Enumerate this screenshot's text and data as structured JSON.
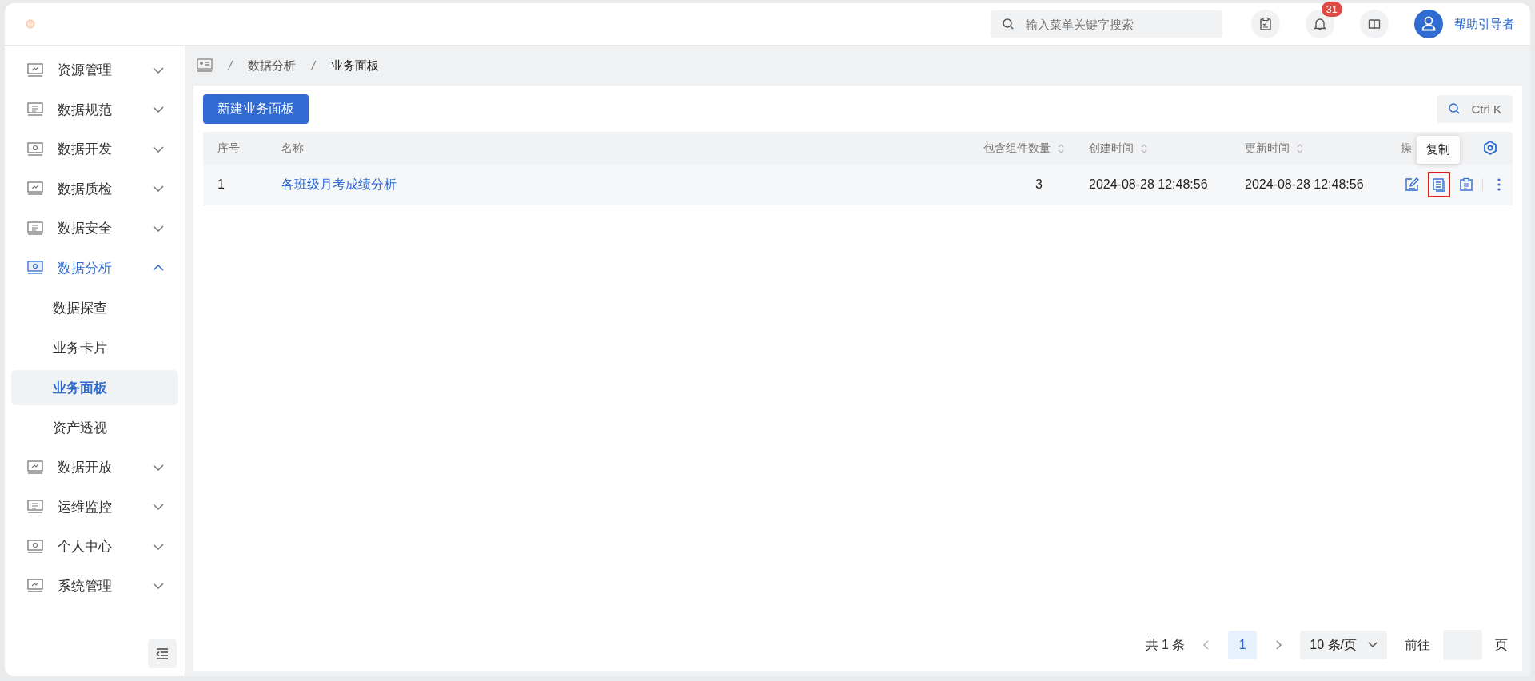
{
  "header": {
    "search": {
      "placeholder": "输入菜单关键字搜索"
    },
    "notifications": {
      "count": "31"
    },
    "user": {
      "name": "帮助引导者"
    }
  },
  "sidebar": {
    "items": [
      {
        "label": "资源管理",
        "expanded": false,
        "selected": false
      },
      {
        "label": "数据规范",
        "expanded": false,
        "selected": false
      },
      {
        "label": "数据开发",
        "expanded": false,
        "selected": false
      },
      {
        "label": "数据质检",
        "expanded": false,
        "selected": false
      },
      {
        "label": "数据安全",
        "expanded": false,
        "selected": false
      },
      {
        "label": "数据分析",
        "expanded": true,
        "selected": true,
        "children": [
          {
            "label": "数据探查",
            "selected": false
          },
          {
            "label": "业务卡片",
            "selected": false
          },
          {
            "label": "业务面板",
            "selected": true
          },
          {
            "label": "资产透视",
            "selected": false
          }
        ]
      },
      {
        "label": "数据开放",
        "expanded": false,
        "selected": false
      },
      {
        "label": "运维监控",
        "expanded": false,
        "selected": false
      },
      {
        "label": "个人中心",
        "expanded": false,
        "selected": false
      },
      {
        "label": "系统管理",
        "expanded": false,
        "selected": false
      }
    ]
  },
  "breadcrumb": [
    "数据分析",
    "业务面板"
  ],
  "toolbar": {
    "new_button": "新建业务面板",
    "search_shortcut": "Ctrl K"
  },
  "table": {
    "columns": [
      {
        "label": "序号",
        "sortable": false
      },
      {
        "label": "名称",
        "sortable": false
      },
      {
        "label": "包含组件数量",
        "sortable": true
      },
      {
        "label": "创建时间",
        "sortable": true
      },
      {
        "label": "更新时间",
        "sortable": true
      },
      {
        "label": "操",
        "sortable": false
      }
    ],
    "rows": [
      {
        "index": "1",
        "name": "各班级月考成绩分析",
        "components": "3",
        "created": "2024-08-28 12:48:56",
        "updated": "2024-08-28 12:48:56",
        "actions": [
          {
            "kind": "edit",
            "highlighted": false
          },
          {
            "kind": "copy",
            "highlighted": true,
            "tooltip": "复制"
          },
          {
            "kind": "export",
            "highlighted": false
          },
          {
            "kind": "more",
            "highlighted": false
          }
        ]
      }
    ]
  },
  "pagination": {
    "total": "共 1 条",
    "pages": [
      {
        "label": "1",
        "selected": true
      }
    ],
    "page_size": "10 条/页",
    "goto_label": "前往",
    "goto_suffix": "页"
  }
}
